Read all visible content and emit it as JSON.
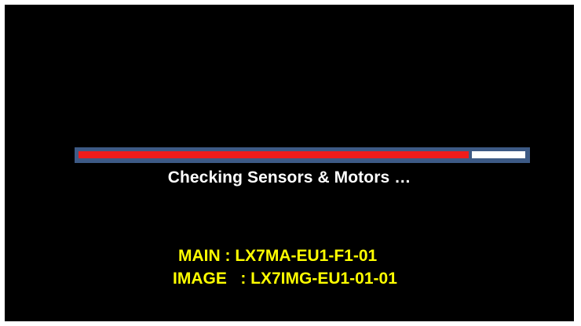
{
  "loading_screen": {
    "progress": 0.88,
    "status_text": "Checking Sensors & Motors …",
    "firmware": {
      "main": "MAIN : LX7MA-EU1-F1-01",
      "image": "IMAGE   : LX7IMG-EU1-01-01"
    }
  },
  "colors": {
    "background": "#000000",
    "progress_fill": "#ee1c1c",
    "progress_track": "#ffffff",
    "progress_frame": "#3d5a85",
    "status_text": "#ffffff",
    "version_text": "#ffff00"
  }
}
